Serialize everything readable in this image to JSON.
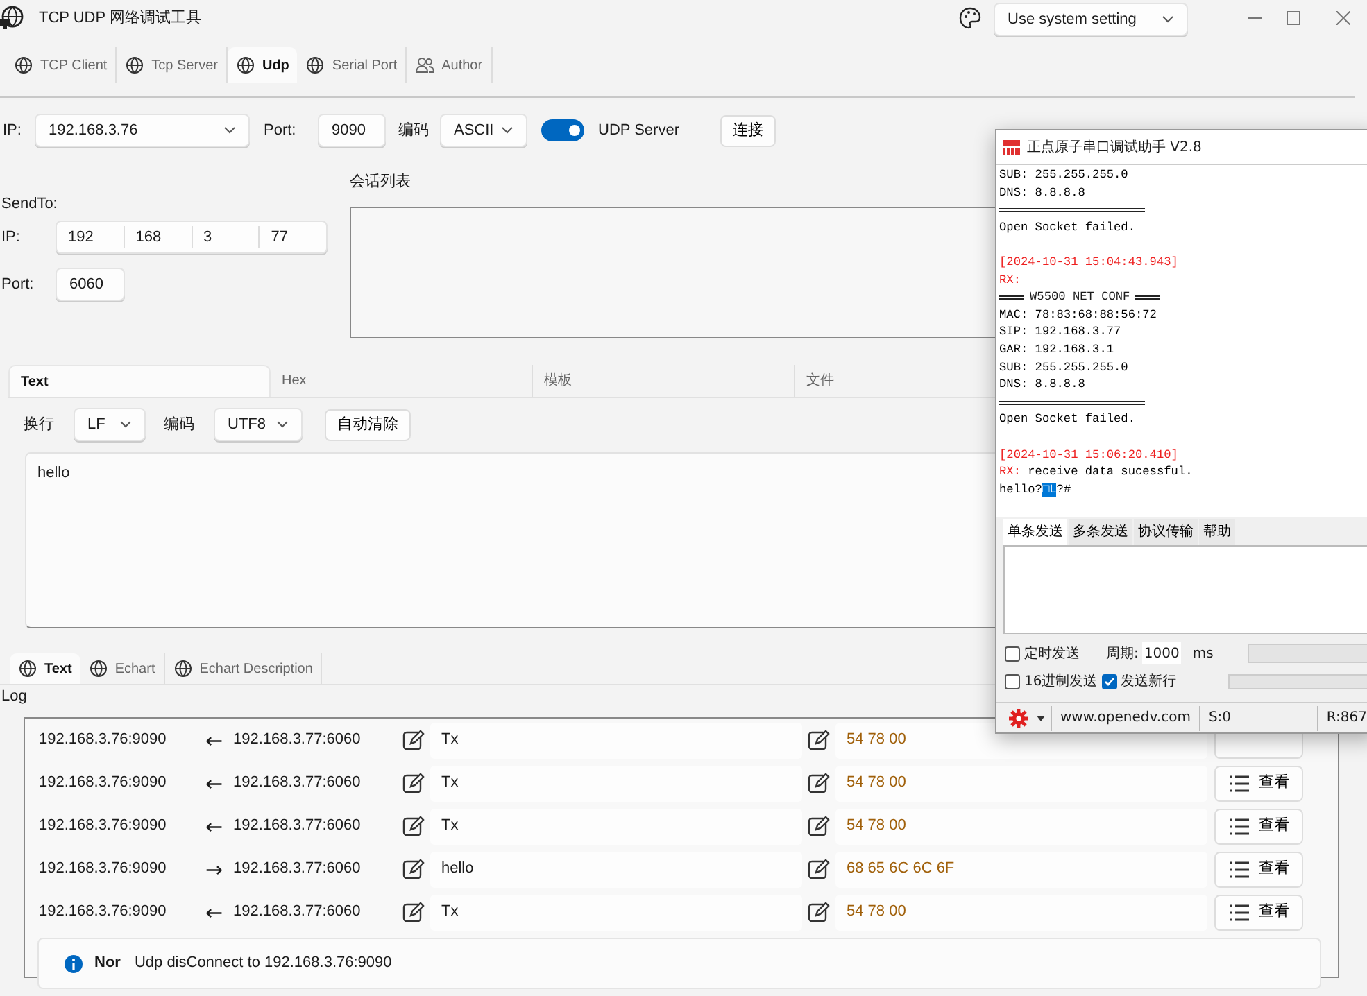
{
  "window": {
    "title": "TCP UDP 网络调试工具",
    "theme_select": "Use system setting"
  },
  "tabs": [
    {
      "label": "TCP Client",
      "selected": false
    },
    {
      "label": "Tcp Server",
      "selected": false
    },
    {
      "label": "Udp",
      "selected": true
    },
    {
      "label": "Serial Port",
      "selected": false
    },
    {
      "label": "Author",
      "selected": false
    }
  ],
  "connection": {
    "ip_label": "IP:",
    "ip": "192.168.3.76",
    "port_label": "Port:",
    "port": "9090",
    "encoding_label": "编码",
    "encoding": "ASCII",
    "server_toggle": {
      "label": "UDP Server",
      "on": true
    },
    "connect_button": "连接"
  },
  "send_to": {
    "title": "SendTo:",
    "ip_label": "IP:",
    "ip_parts": [
      "192",
      "168",
      "3",
      "77"
    ],
    "port_label": "Port:",
    "port": "6060"
  },
  "session_list": {
    "title": "会话列表"
  },
  "send_tabs": [
    {
      "label": "Text",
      "selected": true
    },
    {
      "label": "Hex",
      "selected": false
    },
    {
      "label": "模板",
      "selected": false
    },
    {
      "label": "文件",
      "selected": false
    }
  ],
  "send_options": {
    "newline_label": "换行",
    "newline": "LF",
    "encoding_label": "编码",
    "encoding": "UTF8",
    "auto_clear_button": "自动清除"
  },
  "message": "hello",
  "log_tabs": [
    {
      "label": "Text",
      "selected": true
    },
    {
      "label": "Echart",
      "selected": false
    },
    {
      "label": "Echart Description",
      "selected": false
    }
  ],
  "log": {
    "title": "Log",
    "rows": [
      {
        "local": "192.168.3.76:9090",
        "direction": "←",
        "remote": "192.168.3.77:6060",
        "text": "Tx",
        "hex": "54 78 00"
      },
      {
        "local": "192.168.3.76:9090",
        "direction": "←",
        "remote": "192.168.3.77:6060",
        "text": "Tx",
        "hex": "54 78 00",
        "view_button": "查看"
      },
      {
        "local": "192.168.3.76:9090",
        "direction": "←",
        "remote": "192.168.3.77:6060",
        "text": "Tx",
        "hex": "54 78 00",
        "view_button": "查看"
      },
      {
        "local": "192.168.3.76:9090",
        "direction": "→",
        "remote": "192.168.3.77:6060",
        "text": "hello",
        "hex": "68 65 6C 6C  6F",
        "view_button": "查看"
      },
      {
        "local": "192.168.3.76:9090",
        "direction": "←",
        "remote": "192.168.3.77:6060",
        "text": "Tx",
        "hex": "54 78 00",
        "view_button": "查看"
      }
    ],
    "status": {
      "level": "Nor",
      "message": "Udp disConnect to 192.168.3.76:9090"
    }
  },
  "serial_assistant": {
    "title": "正点原子串口调试助手 V2.8",
    "lines": [
      {
        "kind": "text",
        "segments": [
          {
            "text": "SUB: 255.255.255.0",
            "color": "#000000",
            "selected": false
          }
        ]
      },
      {
        "kind": "text",
        "segments": [
          {
            "text": "DNS: 8.8.8.8",
            "color": "#000000",
            "selected": false
          }
        ]
      },
      {
        "kind": "rule"
      },
      {
        "kind": "text",
        "segments": [
          {
            "text": "Open Socket failed.",
            "color": "#000000",
            "selected": false
          }
        ]
      },
      {
        "kind": "blank"
      },
      {
        "kind": "text",
        "segments": [
          {
            "text": "[2024-10-31 15:04:43.943]",
            "color": "#ee2020",
            "selected": false
          }
        ]
      },
      {
        "kind": "text",
        "segments": [
          {
            "text": "RX:",
            "color": "#ee2020",
            "selected": false
          }
        ]
      },
      {
        "kind": "heading",
        "text": "W5500 NET CONF"
      },
      {
        "kind": "text",
        "segments": [
          {
            "text": "MAC: 78:83:68:88:56:72",
            "color": "#000000",
            "selected": false
          }
        ]
      },
      {
        "kind": "text",
        "segments": [
          {
            "text": "SIP: 192.168.3.77",
            "color": "#000000",
            "selected": false
          }
        ]
      },
      {
        "kind": "text",
        "segments": [
          {
            "text": "GAR: 192.168.3.1",
            "color": "#000000",
            "selected": false
          }
        ]
      },
      {
        "kind": "text",
        "segments": [
          {
            "text": "SUB: 255.255.255.0",
            "color": "#000000",
            "selected": false
          }
        ]
      },
      {
        "kind": "text",
        "segments": [
          {
            "text": "DNS: 8.8.8.8",
            "color": "#000000",
            "selected": false
          }
        ]
      },
      {
        "kind": "rule"
      },
      {
        "kind": "text",
        "segments": [
          {
            "text": "Open Socket failed.",
            "color": "#000000",
            "selected": false
          }
        ]
      },
      {
        "kind": "blank"
      },
      {
        "kind": "text",
        "segments": [
          {
            "text": "[2024-10-31 15:06:20.410]",
            "color": "#ee2020",
            "selected": false
          }
        ]
      },
      {
        "kind": "text",
        "segments": [
          {
            "text": "RX:",
            "color": "#ee2020",
            "selected": false
          },
          {
            "text": " receive data sucessful.",
            "color": "#000000",
            "selected": false
          }
        ]
      },
      {
        "kind": "text",
        "segments": [
          {
            "text": "hello?",
            "color": "#000000",
            "selected": false
          },
          {
            "text": "□L",
            "selected": true
          },
          {
            "text": "?#",
            "color": "#000000",
            "selected": false
          }
        ]
      }
    ],
    "tabs": [
      {
        "label": "单条发送",
        "selected": true
      },
      {
        "label": "多条发送",
        "selected": false
      },
      {
        "label": "协议传输",
        "selected": false
      },
      {
        "label": "帮助",
        "selected": false
      }
    ],
    "timed_send": {
      "label": "定时发送",
      "checked": false
    },
    "period_label": "周期:",
    "period": "1000",
    "period_unit": "ms",
    "hex_send": {
      "label": "16进制发送",
      "checked": false
    },
    "newline_send": {
      "label": "发送新行",
      "checked": true
    },
    "status": {
      "site": "www.openedv.com",
      "sent": "S:0",
      "received": "R:867"
    }
  }
}
